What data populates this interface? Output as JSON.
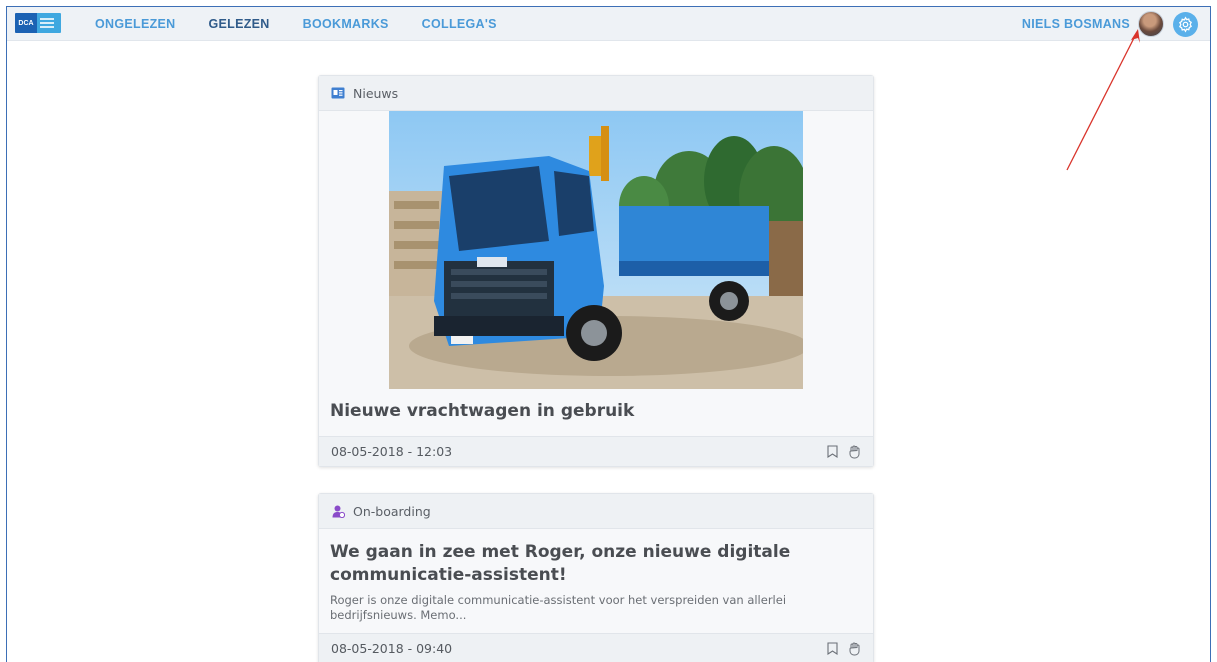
{
  "brand": {
    "logo_text": "DCA"
  },
  "nav": {
    "items": [
      {
        "label": "ONGELEZEN"
      },
      {
        "label": "GELEZEN"
      },
      {
        "label": "BOOKMARKS"
      },
      {
        "label": "COLLEGA'S"
      }
    ]
  },
  "user": {
    "name": "NIELS BOSMANS"
  },
  "cards": [
    {
      "category": "Nieuws",
      "title": "Nieuwe vrachtwagen in gebruik",
      "timestamp": "08-05-2018 - 12:03"
    },
    {
      "category": "On-boarding",
      "title": "We gaan in zee met Roger, onze nieuwe digitale communicatie-assistent!",
      "description": "Roger is onze digitale communicatie-assistent voor het verspreiden van allerlei bedrijfsnieuws. Memo...",
      "timestamp": "08-05-2018 - 09:40"
    }
  ],
  "colors": {
    "accent": "#4a9ad8",
    "nav_active": "#2f5b8a",
    "annotation": "#d9342b"
  }
}
